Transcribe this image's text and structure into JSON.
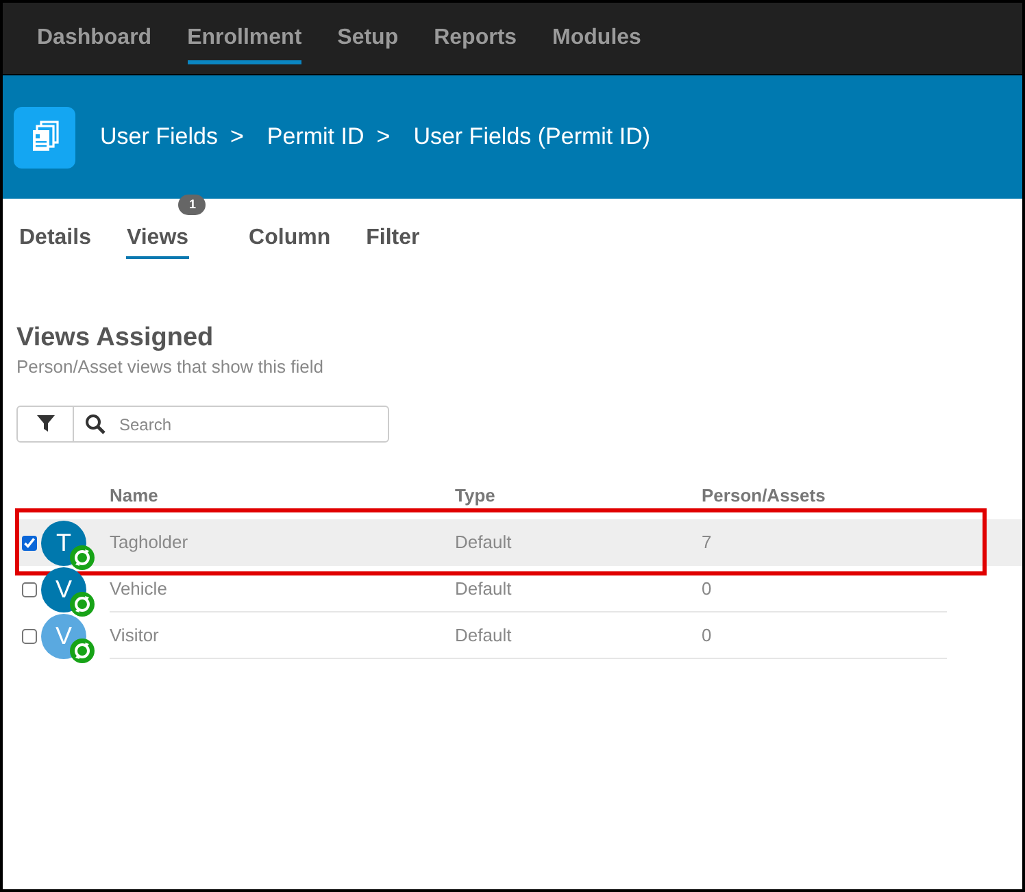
{
  "nav": {
    "items": [
      {
        "label": "Dashboard",
        "selected": false
      },
      {
        "label": "Enrollment",
        "selected": true
      },
      {
        "label": "Setup",
        "selected": false
      },
      {
        "label": "Reports",
        "selected": false
      },
      {
        "label": "Modules",
        "selected": false
      }
    ]
  },
  "header": {
    "breadcrumb": [
      {
        "kind": "link",
        "text": "User Fields"
      },
      {
        "kind": "separator",
        "text": ">"
      },
      {
        "kind": "link",
        "text": "Permit ID"
      },
      {
        "kind": "separator",
        "text": ">"
      },
      {
        "kind": "current",
        "text": "User Fields (Permit ID)"
      }
    ]
  },
  "tabs": [
    {
      "label": "Details",
      "selected": false
    },
    {
      "label": "Views",
      "selected": true,
      "badge": "1"
    },
    {
      "label": "Column",
      "selected": false
    },
    {
      "label": "Filter",
      "selected": false
    }
  ],
  "section": {
    "title": "Views Assigned",
    "subtitle": "Person/Asset views that show this field"
  },
  "search": {
    "placeholder": "Search"
  },
  "table": {
    "columns": [
      "Name",
      "Type",
      "Person/Assets"
    ],
    "rows": [
      {
        "initial": "T",
        "color": "#0078ad",
        "name": "Tagholder",
        "type": "Default",
        "count": "7",
        "checked": true,
        "selected": true
      },
      {
        "initial": "V",
        "color": "#0078ad",
        "name": "Vehicle",
        "type": "Default",
        "count": "0",
        "checked": false,
        "selected": false
      },
      {
        "initial": "V",
        "color": "#5aa9e0",
        "name": "Visitor",
        "type": "Default",
        "count": "0",
        "checked": false,
        "selected": false
      }
    ]
  }
}
